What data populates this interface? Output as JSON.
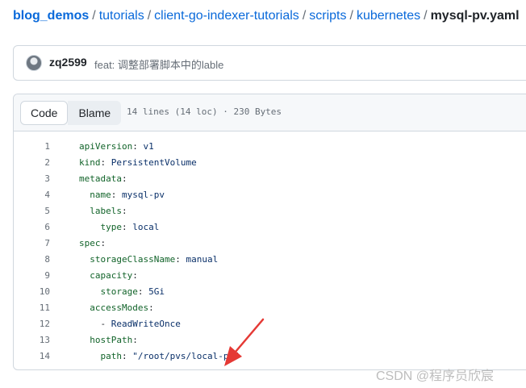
{
  "breadcrumb": {
    "repo": "blog_demos",
    "path": [
      "tutorials",
      "client-go-indexer-tutorials",
      "scripts",
      "kubernetes"
    ],
    "separator": "/",
    "file": "mysql-pv.yaml"
  },
  "commit": {
    "author": "zq2599",
    "message": "feat: 调整部署脚本中的lable"
  },
  "file_header": {
    "code_tab": "Code",
    "blame_tab": "Blame",
    "info": "14 lines (14 loc) · 230 Bytes"
  },
  "code_lines": [
    {
      "n": "1",
      "k": "apiVersion",
      "sep": ": ",
      "v": "v1",
      "indent": ""
    },
    {
      "n": "2",
      "k": "kind",
      "sep": ": ",
      "v": "PersistentVolume",
      "indent": ""
    },
    {
      "n": "3",
      "k": "metadata",
      "sep": ":",
      "v": "",
      "indent": ""
    },
    {
      "n": "4",
      "k": "name",
      "sep": ": ",
      "v": "mysql-pv",
      "indent": "  "
    },
    {
      "n": "5",
      "k": "labels",
      "sep": ":",
      "v": "",
      "indent": "  "
    },
    {
      "n": "6",
      "k": "type",
      "sep": ": ",
      "v": "local",
      "indent": "    "
    },
    {
      "n": "7",
      "k": "spec",
      "sep": ":",
      "v": "",
      "indent": ""
    },
    {
      "n": "8",
      "k": "storageClassName",
      "sep": ": ",
      "v": "manual",
      "indent": "  "
    },
    {
      "n": "9",
      "k": "capacity",
      "sep": ":",
      "v": "",
      "indent": "  "
    },
    {
      "n": "10",
      "k": "storage",
      "sep": ": ",
      "v": "5Gi",
      "indent": "    "
    },
    {
      "n": "11",
      "k": "accessModes",
      "sep": ":",
      "v": "",
      "indent": "  "
    },
    {
      "n": "12",
      "k": "",
      "sep": "- ",
      "v": "ReadWriteOnce",
      "indent": "    "
    },
    {
      "n": "13",
      "k": "hostPath",
      "sep": ":",
      "v": "",
      "indent": "  "
    },
    {
      "n": "14",
      "k": "path",
      "sep": ": ",
      "v": "\"/root/pvs/local-pv\"",
      "indent": "    "
    }
  ],
  "watermark": "CSDN @程序员欣宸",
  "colors": {
    "link": "#0969da",
    "key": "#116329",
    "value": "#0a3069",
    "annotation_arrow": "#e53935"
  }
}
